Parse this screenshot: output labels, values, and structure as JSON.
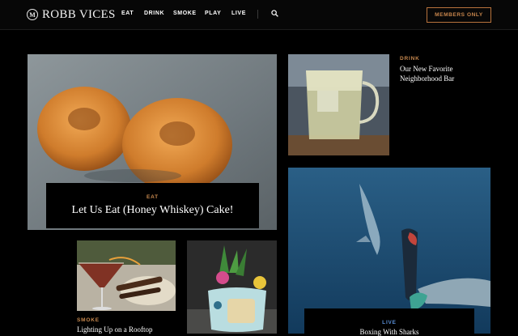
{
  "header": {
    "logo_mark": "M",
    "logo_text": "ROBB VICES",
    "nav": [
      "EAT",
      "DRINK",
      "SMOKE",
      "PLAY",
      "LIVE"
    ],
    "members_label": "MEMBERS ONLY"
  },
  "articles": [
    {
      "category": "EAT",
      "title": "Let Us Eat (Honey Whiskey) Cake!"
    },
    {
      "category": "DRINK",
      "title": "Our New Favorite Neighborhood Bar"
    },
    {
      "category": "SMOKE",
      "title": "Lighting Up on a Rooftop"
    },
    {
      "category": "LIVE",
      "title": "Boxing With Sharks"
    }
  ],
  "colors": {
    "accent": "#c7884e",
    "live_blue": "#5a8fd8",
    "background": "#000000"
  }
}
